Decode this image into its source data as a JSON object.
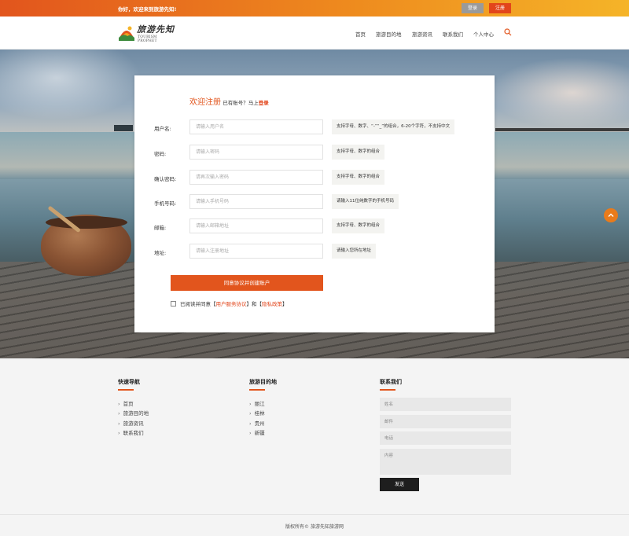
{
  "topbar": {
    "welcome": "你好，欢迎来到旅游先知!",
    "login_label": "登录",
    "register_label": "注册"
  },
  "header": {
    "logo_title": "旅游先知",
    "logo_subtitle": "TOURISM PROPHET",
    "nav": [
      "首页",
      "旅游目的地",
      "旅游资讯",
      "联系我们",
      "个人中心"
    ],
    "search_icon": "search-icon"
  },
  "form": {
    "heading_main": "欢迎注册",
    "heading_sub": "已有账号？马上",
    "heading_link": "登录",
    "fields": [
      {
        "label": "用户名:",
        "placeholder": "请输入用户名",
        "hint": "支持字母、数字、“-”“_”的组合，6-20个字符，不支持中文"
      },
      {
        "label": "密码:",
        "placeholder": "请输入密码",
        "hint": "支持字母、数字的组合"
      },
      {
        "label": "确认密码:",
        "placeholder": "请再次输入密码",
        "hint": "支持字母、数字的组合"
      },
      {
        "label": "手机号码:",
        "placeholder": "请输入手机号码",
        "hint": "请输入11位纯数字的手机号码"
      },
      {
        "label": "邮箱:",
        "placeholder": "请输入邮箱地址",
        "hint": "支持字母、数字的组合"
      },
      {
        "label": "地址:",
        "placeholder": "请输入注册地址",
        "hint": "请输入您所在地址"
      }
    ],
    "submit_label": "同意协议并创建账户",
    "agree_prefix": "已阅读并同意【",
    "agree_link1": "用户服务协议",
    "agree_mid": "】和【",
    "agree_link2": "隐私政策",
    "agree_suffix": "】"
  },
  "footer": {
    "col1_title": "快速导航",
    "col1_links": [
      "首页",
      "旅游目的地",
      "旅游资讯",
      "联系我们"
    ],
    "col2_title": "旅游目的地",
    "col2_links": [
      "丽江",
      "桂林",
      "贵州",
      "新疆"
    ],
    "col3_title": "联系我们",
    "contact_name_placeholder": "姓名",
    "contact_email_placeholder": "邮件",
    "contact_phone_placeholder": "电话",
    "contact_content_placeholder": "内容",
    "send_label": "发送",
    "copyright": "版权所有© 旅游先知旅游网"
  },
  "colors": {
    "accent": "#e2551d",
    "topbar_end": "#f5b428",
    "login_button": "#9a9a9a",
    "send_button": "#1e1e1e"
  }
}
